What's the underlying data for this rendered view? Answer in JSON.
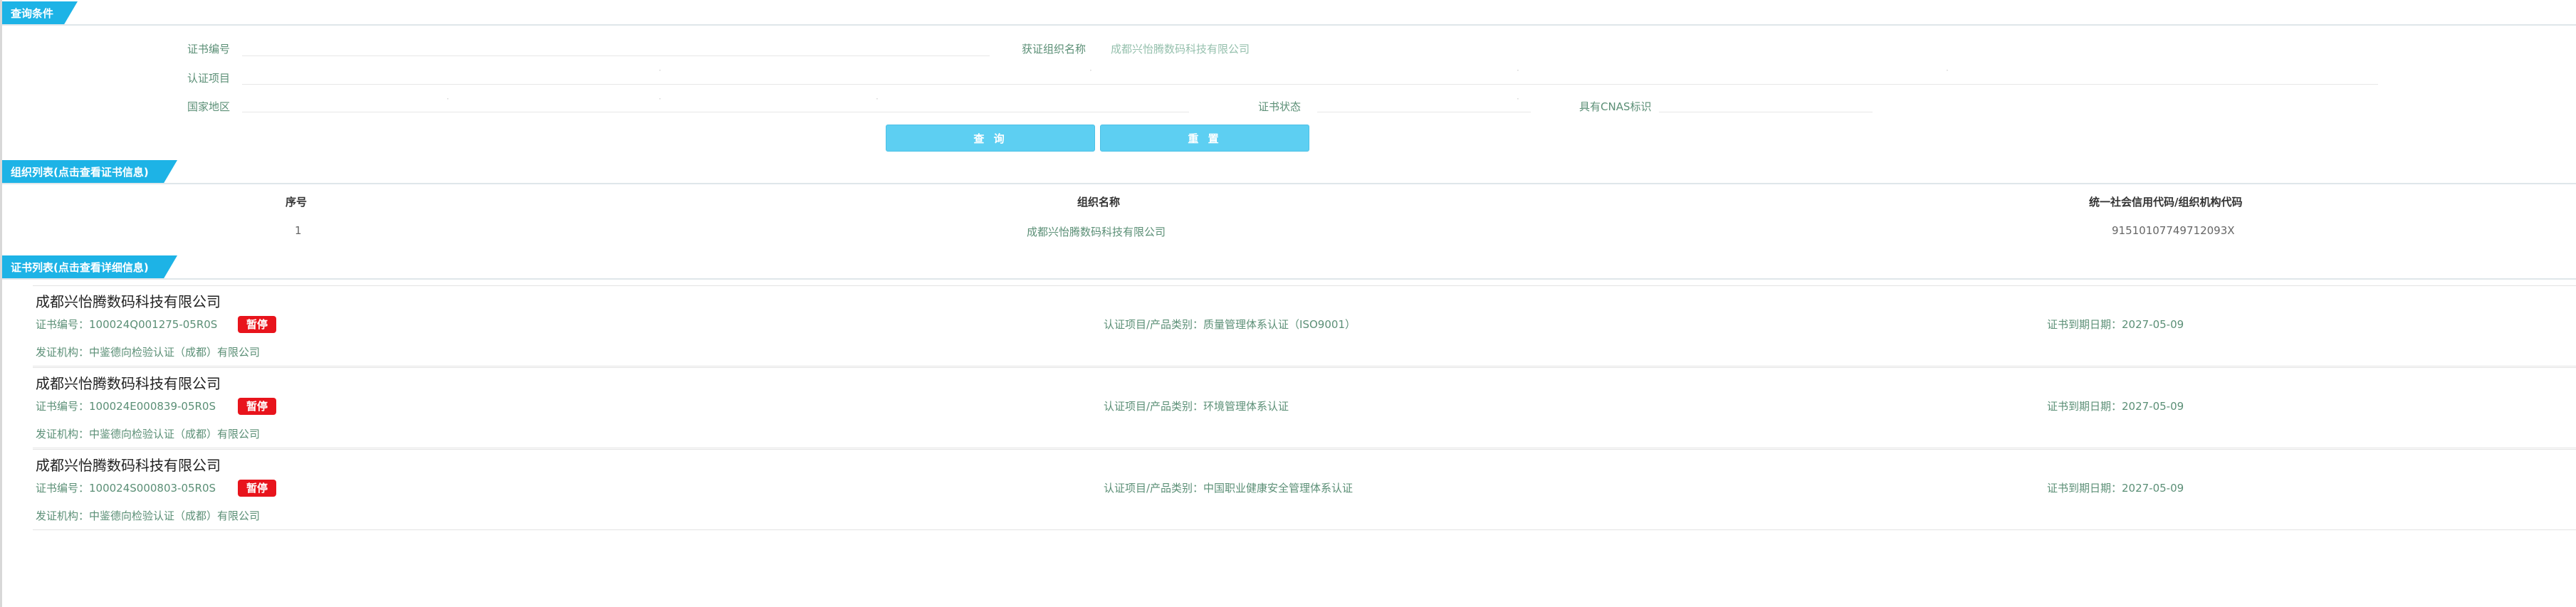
{
  "query": {
    "section_title": "查询条件",
    "cert_no_label": "证书编号",
    "org_name_label": "获证组织名称",
    "org_name_value": "成都兴怡腾数码科技有限公司",
    "cert_project_label": "认证项目",
    "country_label": "国家地区",
    "cert_status_label": "证书状态",
    "cnas_label": "具有CNAS标识",
    "search_button": "查 询",
    "reset_button": "重 置"
  },
  "orgs": {
    "section_title": "组织列表(点击查看证书信息)",
    "headers": [
      "序号",
      "组织名称",
      "统一社会信用代码/组织机构代码"
    ],
    "rows": [
      {
        "index": "1",
        "name": "成都兴怡腾数码科技有限公司",
        "code": "91510107749712093X"
      }
    ]
  },
  "certs": {
    "section_title": "证书列表(点击查看详细信息)",
    "items": [
      {
        "company": "成都兴怡腾数码科技有限公司",
        "cert_no": "证书编号：100024Q001275-05R0S",
        "status": "暂停",
        "category": "认证项目/产品类别：质量管理体系认证（ISO9001）",
        "expiry": "证书到期日期：2027-05-09",
        "issuer": "发证机构：中鉴德向检验认证（成都）有限公司"
      },
      {
        "company": "成都兴怡腾数码科技有限公司",
        "cert_no": "证书编号：100024E000839-05R0S",
        "status": "暂停",
        "category": "认证项目/产品类别：环境管理体系认证",
        "expiry": "证书到期日期：2027-05-09",
        "issuer": "发证机构：中鉴德向检验认证（成都）有限公司"
      },
      {
        "company": "成都兴怡腾数码科技有限公司",
        "cert_no": "证书编号：100024S000803-05R0S",
        "status": "暂停",
        "category": "认证项目/产品类别：中国职业健康安全管理体系认证",
        "expiry": "证书到期日期：2027-05-09",
        "issuer": "发证机构：中鉴德向检验认证（成都）有限公司"
      }
    ]
  },
  "colors": {
    "accent": "#1db3e6",
    "button": "#5dcff2",
    "status_badge": "#e8141c",
    "label_green": "#5b8f76"
  }
}
